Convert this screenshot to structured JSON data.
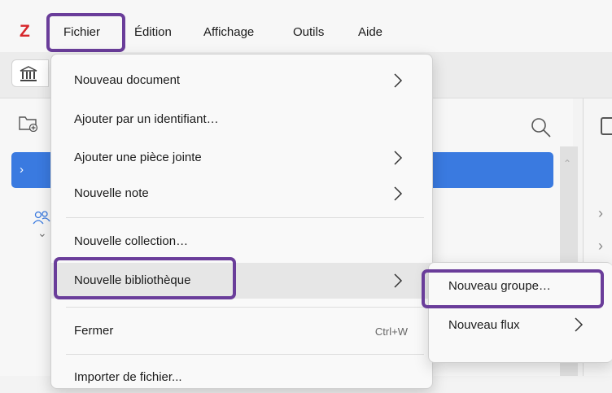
{
  "app": {
    "logo": "Z"
  },
  "menubar": {
    "items": [
      {
        "label": "Fichier"
      },
      {
        "label": "Édition"
      },
      {
        "label": "Affichage"
      },
      {
        "label": "Outils"
      },
      {
        "label": "Aide"
      }
    ]
  },
  "file_menu": {
    "items": [
      {
        "label": "Nouveau document",
        "has_submenu": true
      },
      {
        "label": "Ajouter par un identifiant…",
        "has_submenu": false
      },
      {
        "label": "Ajouter une pièce jointe",
        "has_submenu": true
      },
      {
        "label": "Nouvelle note",
        "has_submenu": true
      },
      {
        "label": "Nouvelle collection…",
        "has_submenu": false
      },
      {
        "label": "Nouvelle bibliothèque",
        "has_submenu": true
      },
      {
        "label": "Fermer",
        "shortcut": "Ctrl+W"
      },
      {
        "label": "Importer de fichier..."
      }
    ]
  },
  "library_submenu": {
    "items": [
      {
        "label": "Nouveau groupe…"
      },
      {
        "label": "Nouveau flux",
        "has_submenu": true
      }
    ]
  },
  "colors": {
    "highlight": "#6a3d9a",
    "accent": "#3a7ae0",
    "logo": "#d7262b"
  },
  "icons": {
    "library": "library-icon",
    "new-collection": "new-collection-icon",
    "search": "search-icon",
    "group": "group-icon"
  }
}
